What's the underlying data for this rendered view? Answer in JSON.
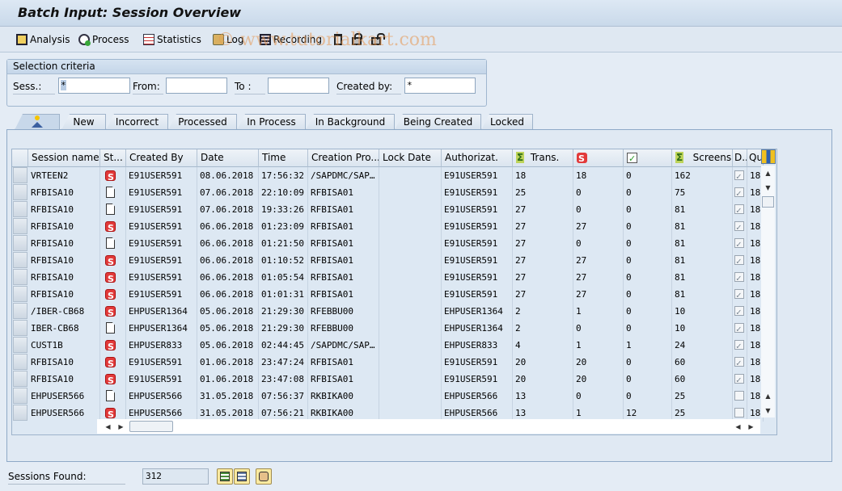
{
  "window": {
    "title": "Batch Input: Session Overview"
  },
  "toolbar": {
    "buttons": [
      {
        "label": "Analysis",
        "icon": "analysis-icon"
      },
      {
        "label": "Process",
        "icon": "process-icon"
      },
      {
        "label": "Statistics",
        "icon": "statistics-icon"
      },
      {
        "label": "Log",
        "icon": "log-icon"
      },
      {
        "label": "Recording",
        "icon": "recording-icon"
      }
    ],
    "icon_buttons": [
      "delete-icon",
      "lock-icon",
      "unlock-icon"
    ],
    "watermark": "© www.tutorialkart.com"
  },
  "selection": {
    "title": "Selection criteria",
    "sess_label": "Sess.:",
    "sess_value": "*",
    "from_label": "From:",
    "from_value": "",
    "to_label": "To :",
    "to_value": "",
    "created_by_label": "Created by:",
    "created_by_value": "*"
  },
  "tabs": [
    {
      "label": "",
      "icon": "all-sessions-icon",
      "active": true
    },
    {
      "label": "New"
    },
    {
      "label": "Incorrect"
    },
    {
      "label": "Processed"
    },
    {
      "label": "In Process"
    },
    {
      "label": "In Background"
    },
    {
      "label": "Being Created"
    },
    {
      "label": "Locked"
    }
  ],
  "table": {
    "columns": [
      "Session name",
      "St...",
      "Created By",
      "Date",
      "Time",
      "Creation Pro...",
      "Lock Date",
      "Authorizat.",
      "Trans.",
      "",
      "",
      "Screens",
      "D..",
      "Qu"
    ],
    "column_icons": {
      "trans": "sigma-icon",
      "errors": "error-status-icon",
      "processed": "processed-check-icon",
      "screens": "sigma-icon"
    },
    "rows": [
      {
        "name": "VRTEEN2",
        "status": "error",
        "created_by": "E91USER591",
        "date": "08.06.2018",
        "time": "17:56:32",
        "program": "/SAPDMC/SAP…",
        "lock_date": "",
        "auth": "E91USER591",
        "trans": "18",
        "errors": "18",
        "processed": "0",
        "screens": "162",
        "d": true,
        "q": "18"
      },
      {
        "name": "RFBISA10",
        "status": "new",
        "created_by": "E91USER591",
        "date": "07.06.2018",
        "time": "22:10:09",
        "program": "RFBISA01",
        "lock_date": "",
        "auth": "E91USER591",
        "trans": "25",
        "errors": "0",
        "processed": "0",
        "screens": "75",
        "d": true,
        "q": "18"
      },
      {
        "name": "RFBISA10",
        "status": "new",
        "created_by": "E91USER591",
        "date": "07.06.2018",
        "time": "19:33:26",
        "program": "RFBISA01",
        "lock_date": "",
        "auth": "E91USER591",
        "trans": "27",
        "errors": "0",
        "processed": "0",
        "screens": "81",
        "d": true,
        "q": "18"
      },
      {
        "name": "RFBISA10",
        "status": "error",
        "created_by": "E91USER591",
        "date": "06.06.2018",
        "time": "01:23:09",
        "program": "RFBISA01",
        "lock_date": "",
        "auth": "E91USER591",
        "trans": "27",
        "errors": "27",
        "processed": "0",
        "screens": "81",
        "d": true,
        "q": "18"
      },
      {
        "name": "RFBISA10",
        "status": "new",
        "created_by": "E91USER591",
        "date": "06.06.2018",
        "time": "01:21:50",
        "program": "RFBISA01",
        "lock_date": "",
        "auth": "E91USER591",
        "trans": "27",
        "errors": "0",
        "processed": "0",
        "screens": "81",
        "d": true,
        "q": "18"
      },
      {
        "name": "RFBISA10",
        "status": "error",
        "created_by": "E91USER591",
        "date": "06.06.2018",
        "time": "01:10:52",
        "program": "RFBISA01",
        "lock_date": "",
        "auth": "E91USER591",
        "trans": "27",
        "errors": "27",
        "processed": "0",
        "screens": "81",
        "d": true,
        "q": "18"
      },
      {
        "name": "RFBISA10",
        "status": "error",
        "created_by": "E91USER591",
        "date": "06.06.2018",
        "time": "01:05:54",
        "program": "RFBISA01",
        "lock_date": "",
        "auth": "E91USER591",
        "trans": "27",
        "errors": "27",
        "processed": "0",
        "screens": "81",
        "d": true,
        "q": "18"
      },
      {
        "name": "RFBISA10",
        "status": "error",
        "created_by": "E91USER591",
        "date": "06.06.2018",
        "time": "01:01:31",
        "program": "RFBISA01",
        "lock_date": "",
        "auth": "E91USER591",
        "trans": "27",
        "errors": "27",
        "processed": "0",
        "screens": "81",
        "d": true,
        "q": "18"
      },
      {
        "name": "/IBER-CB68",
        "status": "error",
        "created_by": "EHPUSER1364",
        "date": "05.06.2018",
        "time": "21:29:30",
        "program": "RFEBBU00",
        "lock_date": "",
        "auth": "EHPUSER1364",
        "trans": "2",
        "errors": "1",
        "processed": "0",
        "screens": "10",
        "d": true,
        "q": "18"
      },
      {
        "name": "IBER-CB68",
        "status": "new",
        "created_by": "EHPUSER1364",
        "date": "05.06.2018",
        "time": "21:29:30",
        "program": "RFEBBU00",
        "lock_date": "",
        "auth": "EHPUSER1364",
        "trans": "2",
        "errors": "0",
        "processed": "0",
        "screens": "10",
        "d": true,
        "q": "18"
      },
      {
        "name": "CUST1B",
        "status": "error",
        "created_by": "EHPUSER833",
        "date": "05.06.2018",
        "time": "02:44:45",
        "program": "/SAPDMC/SAP…",
        "lock_date": "",
        "auth": "EHPUSER833",
        "trans": "4",
        "errors": "1",
        "processed": "1",
        "screens": "24",
        "d": true,
        "q": "18"
      },
      {
        "name": "RFBISA10",
        "status": "error",
        "created_by": "E91USER591",
        "date": "01.06.2018",
        "time": "23:47:24",
        "program": "RFBISA01",
        "lock_date": "",
        "auth": "E91USER591",
        "trans": "20",
        "errors": "20",
        "processed": "0",
        "screens": "60",
        "d": true,
        "q": "18"
      },
      {
        "name": "RFBISA10",
        "status": "error",
        "created_by": "E91USER591",
        "date": "01.06.2018",
        "time": "23:47:08",
        "program": "RFBISA01",
        "lock_date": "",
        "auth": "E91USER591",
        "trans": "20",
        "errors": "20",
        "processed": "0",
        "screens": "60",
        "d": true,
        "q": "18"
      },
      {
        "name": "EHPUSER566",
        "status": "new",
        "created_by": "EHPUSER566",
        "date": "31.05.2018",
        "time": "07:56:37",
        "program": "RKBIKA00",
        "lock_date": "",
        "auth": "EHPUSER566",
        "trans": "13",
        "errors": "0",
        "processed": "0",
        "screens": "25",
        "d": false,
        "q": "18"
      },
      {
        "name": "EHPUSER566",
        "status": "error",
        "created_by": "EHPUSER566",
        "date": "31.05.2018",
        "time": "07:56:21",
        "program": "RKBIKA00",
        "lock_date": "",
        "auth": "EHPUSER566",
        "trans": "13",
        "errors": "1",
        "processed": "12",
        "screens": "25",
        "d": false,
        "q": "18"
      }
    ]
  },
  "footer": {
    "sessions_found_label": "Sessions Found:",
    "sessions_found_value": "312",
    "buttons": [
      "select-all-icon",
      "deselect-all-icon",
      "session-info-icon"
    ]
  },
  "colors": {
    "error_status": "#e23a3a",
    "sigma": "#bed45a",
    "background": "#e4ecf5"
  }
}
